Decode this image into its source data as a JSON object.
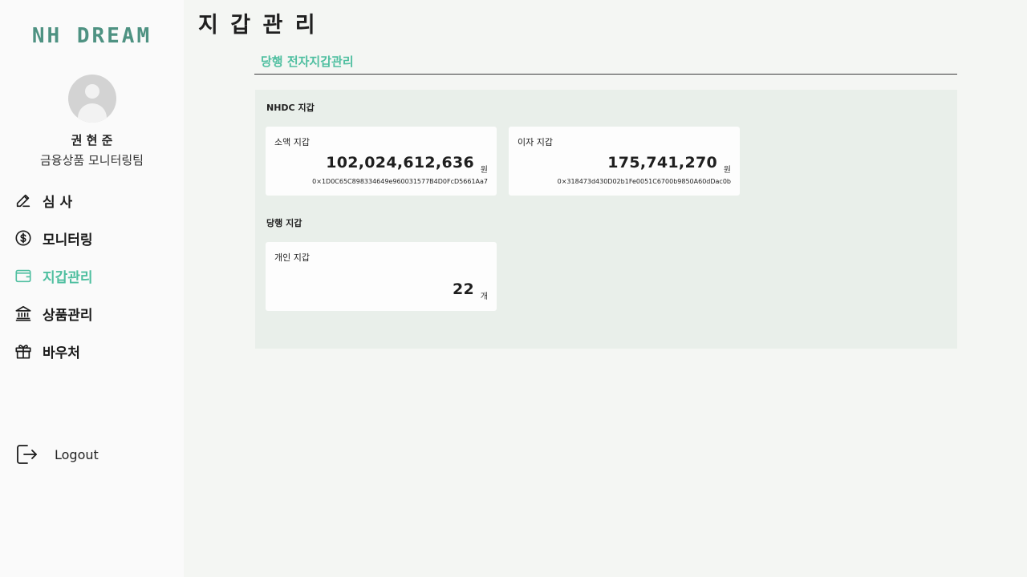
{
  "brand": {
    "logo_text": "NH DREAM",
    "accent": "#4fbfa0",
    "logo_color": "#4e9282"
  },
  "user": {
    "name": "권 현 준",
    "team": "금융상품 모니터링팀"
  },
  "nav": {
    "items": [
      {
        "label": "심 사",
        "icon": "pencil-icon"
      },
      {
        "label": "모니터링",
        "icon": "dollar-circle-icon"
      },
      {
        "label": "지갑관리",
        "icon": "wallet-icon",
        "active": true
      },
      {
        "label": "상품관리",
        "icon": "bank-icon"
      },
      {
        "label": "바우처",
        "icon": "gift-icon"
      }
    ],
    "logout_label": "Logout"
  },
  "page": {
    "title": "지 갑 관 리",
    "section_title": "당행 전자지갑관리"
  },
  "nhdc_wallets": {
    "label": "NHDC 지갑",
    "cards": [
      {
        "label": "소액 지갑",
        "amount": "102,024,612,636",
        "unit": "원",
        "address": "0×1D0C65C898334649e960031577B4D0FcD5661Aa7"
      },
      {
        "label": "이자 지갑",
        "amount": "175,741,270",
        "unit": "원",
        "address": "0×318473d430D02b1Fe0051C6700b9850A60dDac0b"
      }
    ]
  },
  "bank_wallets": {
    "label": "당행 지갑",
    "cards": [
      {
        "label": "개인 지갑",
        "amount": "22",
        "unit": "개"
      }
    ]
  }
}
